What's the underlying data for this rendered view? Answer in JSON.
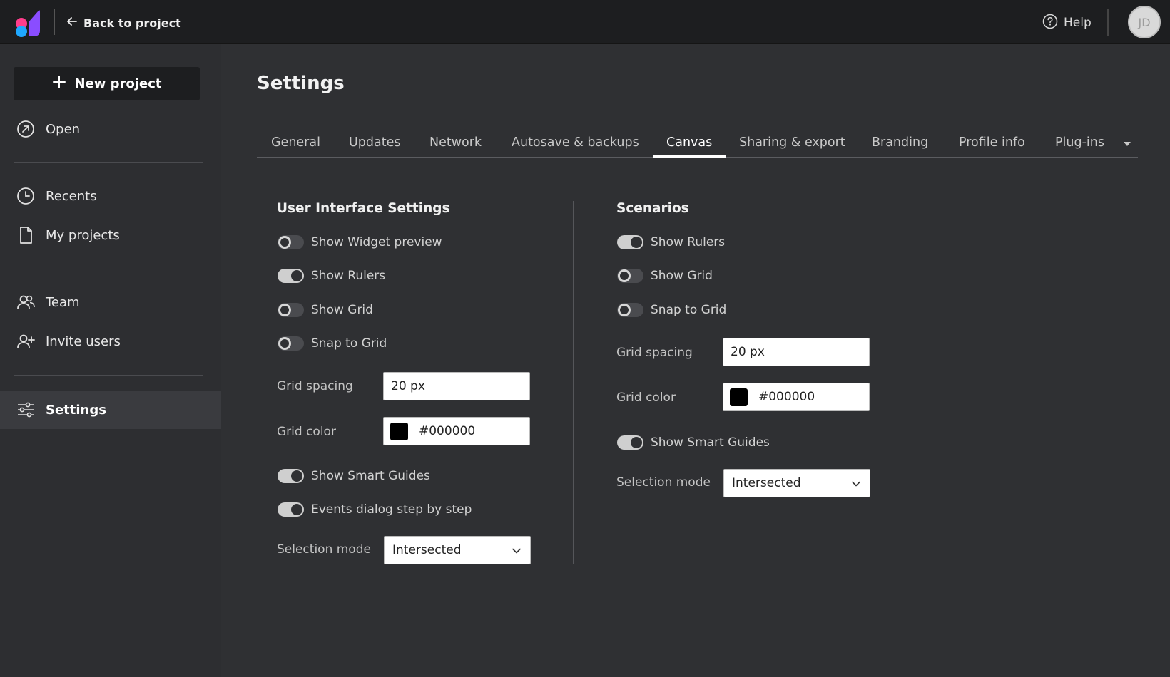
{
  "header": {
    "back_label": "Back to project",
    "help_label": "Help",
    "avatar_initials": "JD"
  },
  "sidebar": {
    "new_project_label": "New project",
    "items": [
      {
        "label": "Open",
        "icon": "open-icon"
      },
      {
        "label": "Recents",
        "icon": "clock-icon"
      },
      {
        "label": "My projects",
        "icon": "file-icon"
      },
      {
        "label": "Team",
        "icon": "team-icon"
      },
      {
        "label": "Invite users",
        "icon": "invite-user-icon"
      },
      {
        "label": "Settings",
        "icon": "sliders-icon",
        "active": true
      }
    ]
  },
  "main": {
    "title": "Settings",
    "tabs": [
      {
        "label": "General"
      },
      {
        "label": "Updates"
      },
      {
        "label": "Network"
      },
      {
        "label": "Autosave & backups"
      },
      {
        "label": "Canvas",
        "active": true
      },
      {
        "label": "Sharing & export"
      },
      {
        "label": "Branding"
      },
      {
        "label": "Profile info"
      },
      {
        "label": "Plug-ins"
      }
    ],
    "ui_settings": {
      "title": "User Interface Settings",
      "toggles": [
        {
          "label": "Show Widget preview",
          "on": false
        },
        {
          "label": "Show Rulers",
          "on": true
        },
        {
          "label": "Show Grid",
          "on": false
        },
        {
          "label": "Snap to Grid",
          "on": false
        }
      ],
      "grid_spacing_label": "Grid spacing",
      "grid_spacing_value": "20 px",
      "grid_color_label": "Grid color",
      "grid_color_value": "#000000",
      "toggles_bottom": [
        {
          "label": "Show Smart Guides",
          "on": true
        },
        {
          "label": "Events dialog step by step",
          "on": true
        }
      ],
      "selection_mode_label": "Selection mode",
      "selection_mode_value": "Intersected"
    },
    "scenarios": {
      "title": "Scenarios",
      "toggles": [
        {
          "label": "Show Rulers",
          "on": true
        },
        {
          "label": "Show Grid",
          "on": false
        },
        {
          "label": "Snap to Grid",
          "on": false
        }
      ],
      "grid_spacing_label": "Grid spacing",
      "grid_spacing_value": "20 px",
      "grid_color_label": "Grid color",
      "grid_color_value": "#000000",
      "toggles_bottom": [
        {
          "label": "Show Smart Guides",
          "on": true
        }
      ],
      "selection_mode_label": "Selection mode",
      "selection_mode_value": "Intersected"
    }
  },
  "colors": {
    "background": "#2f3033",
    "topbar": "#1d1e20",
    "sidebar": "#2d2e31",
    "active_item": "#3a3b3f",
    "logo_pink": "#ff3d8b",
    "logo_purple": "#8a4dff",
    "logo_blue": "#1fa8ff"
  }
}
